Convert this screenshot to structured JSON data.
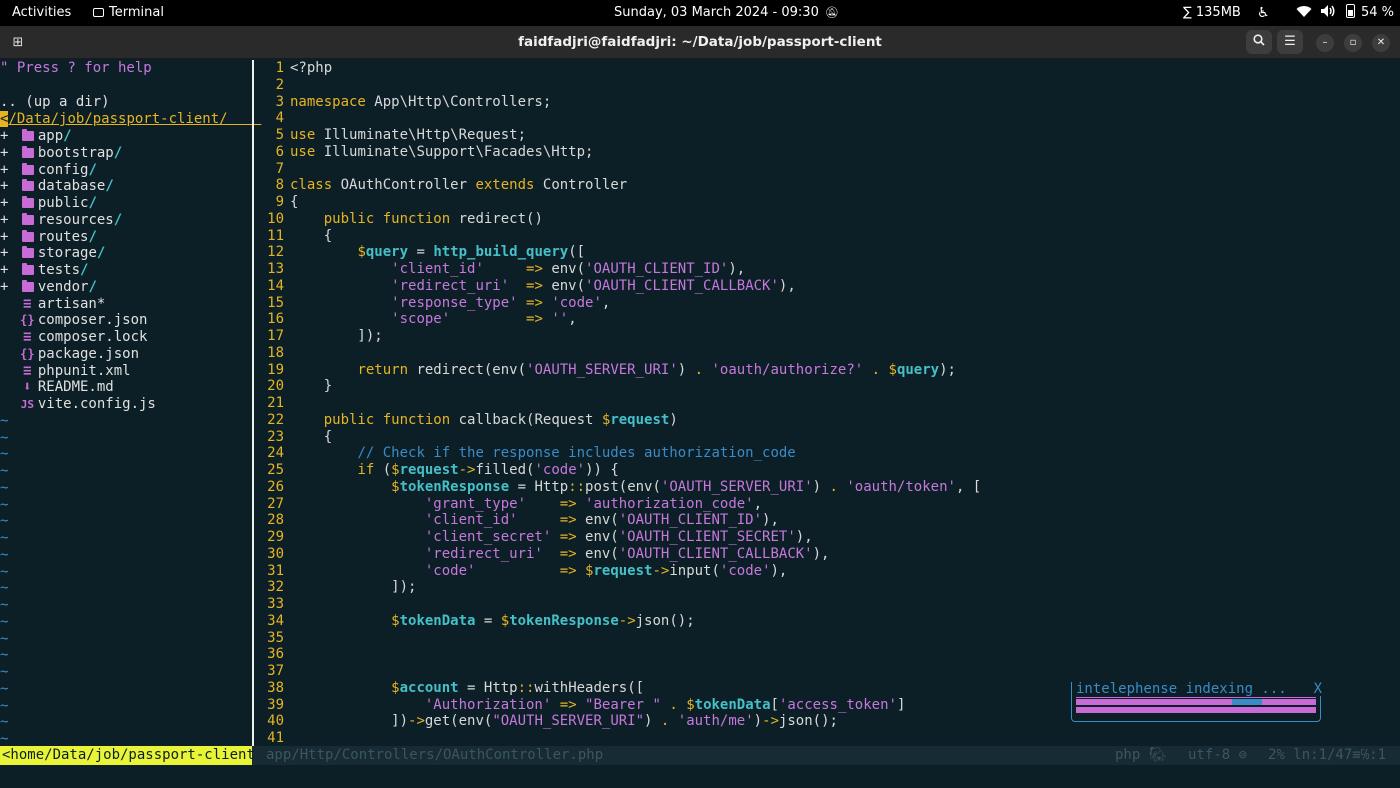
{
  "topbar": {
    "activities": "Activities",
    "app": "Terminal",
    "datetime": "Sunday, 03 March 2024 - 09:30",
    "memory": "∑ 135MB",
    "battery": "54 %"
  },
  "window": {
    "title": "faidfadjri@faidfadjri: ~/Data/job/passport-client"
  },
  "tree": {
    "help": "\" Press ? for help",
    "updir": ".. (up a dir)",
    "cwd": "/Data/job/passport-client/",
    "dirs": [
      "app",
      "bootstrap",
      "config",
      "database",
      "public",
      "resources",
      "routes",
      "storage",
      "tests",
      "vendor"
    ],
    "files": [
      {
        "icon": "text-file-icon",
        "glyph": "≡",
        "name": "artisan*"
      },
      {
        "icon": "json-file-icon",
        "glyph": "{}",
        "name": "composer.json"
      },
      {
        "icon": "text-file-icon",
        "glyph": "≡",
        "name": "composer.lock"
      },
      {
        "icon": "json-file-icon",
        "glyph": "{}",
        "name": "package.json"
      },
      {
        "icon": "text-file-icon",
        "glyph": "≡",
        "name": "phpunit.xml"
      },
      {
        "icon": "markdown-file-icon",
        "glyph": "⬇",
        "name": "README.md"
      },
      {
        "icon": "js-file-icon",
        "glyph": "JS",
        "name": "vite.config.js"
      }
    ],
    "tilde": "~"
  },
  "code": [
    [
      [
        "p",
        "<?php"
      ]
    ],
    [],
    [
      [
        "k",
        "namespace"
      ],
      [
        "p",
        " App\\Http\\Controllers;"
      ]
    ],
    [],
    [
      [
        "k",
        "use"
      ],
      [
        "p",
        " Illuminate\\Http\\Request;"
      ]
    ],
    [
      [
        "k",
        "use"
      ],
      [
        "p",
        " Illuminate\\Support\\Facades\\Http;"
      ]
    ],
    [],
    [
      [
        "k",
        "class"
      ],
      [
        "p",
        " OAuthController "
      ],
      [
        "k",
        "extends"
      ],
      [
        "p",
        " Controller"
      ]
    ],
    [
      [
        "p",
        "{"
      ]
    ],
    [
      [
        "p",
        "    "
      ],
      [
        "k",
        "public"
      ],
      [
        "p",
        " "
      ],
      [
        "k",
        "function"
      ],
      [
        "p",
        " redirect()"
      ]
    ],
    [
      [
        "p",
        "    {"
      ]
    ],
    [
      [
        "p",
        "        "
      ],
      [
        "d",
        "$"
      ],
      [
        "v",
        "query"
      ],
      [
        "p",
        " = "
      ],
      [
        "f",
        "http_build_query"
      ],
      [
        "p",
        "(["
      ]
    ],
    [
      [
        "p",
        "            "
      ],
      [
        "s",
        "'client_id'"
      ],
      [
        "p",
        "     "
      ],
      [
        "o",
        "=>"
      ],
      [
        "p",
        " env("
      ],
      [
        "s",
        "'OAUTH_CLIENT_ID'"
      ],
      [
        "p",
        "),"
      ]
    ],
    [
      [
        "p",
        "            "
      ],
      [
        "s",
        "'redirect_uri'"
      ],
      [
        "p",
        "  "
      ],
      [
        "o",
        "=>"
      ],
      [
        "p",
        " env("
      ],
      [
        "s",
        "'OAUTH_CLIENT_CALLBACK'"
      ],
      [
        "p",
        "),"
      ]
    ],
    [
      [
        "p",
        "            "
      ],
      [
        "s",
        "'response_type'"
      ],
      [
        "p",
        " "
      ],
      [
        "o",
        "=>"
      ],
      [
        "p",
        " "
      ],
      [
        "s",
        "'code'"
      ],
      [
        "p",
        ","
      ]
    ],
    [
      [
        "p",
        "            "
      ],
      [
        "s",
        "'scope'"
      ],
      [
        "p",
        "         "
      ],
      [
        "o",
        "=>"
      ],
      [
        "p",
        " "
      ],
      [
        "s",
        "''"
      ],
      [
        "p",
        ","
      ]
    ],
    [
      [
        "p",
        "        ]);"
      ]
    ],
    [],
    [
      [
        "p",
        "        "
      ],
      [
        "k",
        "return"
      ],
      [
        "p",
        " redirect(env("
      ],
      [
        "s",
        "'OAUTH_SERVER_URI'"
      ],
      [
        "p",
        ") "
      ],
      [
        "o",
        "."
      ],
      [
        "p",
        " "
      ],
      [
        "s",
        "'oauth/authorize?'"
      ],
      [
        "p",
        " "
      ],
      [
        "o",
        "."
      ],
      [
        "p",
        " "
      ],
      [
        "d",
        "$"
      ],
      [
        "v",
        "query"
      ],
      [
        "p",
        ");"
      ]
    ],
    [
      [
        "p",
        "    }"
      ]
    ],
    [],
    [
      [
        "p",
        "    "
      ],
      [
        "k",
        "public"
      ],
      [
        "p",
        " "
      ],
      [
        "k",
        "function"
      ],
      [
        "p",
        " callback(Request "
      ],
      [
        "d",
        "$"
      ],
      [
        "v",
        "request"
      ],
      [
        "p",
        ")"
      ]
    ],
    [
      [
        "p",
        "    {"
      ]
    ],
    [
      [
        "p",
        "        "
      ],
      [
        "c",
        "// Check if the response includes authorization_code"
      ]
    ],
    [
      [
        "p",
        "        "
      ],
      [
        "k",
        "if"
      ],
      [
        "p",
        " ("
      ],
      [
        "d",
        "$"
      ],
      [
        "v",
        "request"
      ],
      [
        "o",
        "->"
      ],
      [
        "p",
        "filled("
      ],
      [
        "s",
        "'code'"
      ],
      [
        "p",
        ")) {"
      ]
    ],
    [
      [
        "p",
        "            "
      ],
      [
        "d",
        "$"
      ],
      [
        "v",
        "tokenResponse"
      ],
      [
        "p",
        " = Http"
      ],
      [
        "o",
        "::"
      ],
      [
        "p",
        "post(env("
      ],
      [
        "s",
        "'OAUTH_SERVER_URI'"
      ],
      [
        "p",
        ") "
      ],
      [
        "o",
        "."
      ],
      [
        "p",
        " "
      ],
      [
        "s",
        "'oauth/token'"
      ],
      [
        "p",
        ", ["
      ]
    ],
    [
      [
        "p",
        "                "
      ],
      [
        "s",
        "'grant_type'"
      ],
      [
        "p",
        "    "
      ],
      [
        "o",
        "=>"
      ],
      [
        "p",
        " "
      ],
      [
        "s",
        "'authorization_code'"
      ],
      [
        "p",
        ","
      ]
    ],
    [
      [
        "p",
        "                "
      ],
      [
        "s",
        "'client_id'"
      ],
      [
        "p",
        "     "
      ],
      [
        "o",
        "=>"
      ],
      [
        "p",
        " env("
      ],
      [
        "s",
        "'OAUTH_CLIENT_ID'"
      ],
      [
        "p",
        "),"
      ]
    ],
    [
      [
        "p",
        "                "
      ],
      [
        "s",
        "'client_secret'"
      ],
      [
        "p",
        " "
      ],
      [
        "o",
        "=>"
      ],
      [
        "p",
        " env("
      ],
      [
        "s",
        "'OAUTH_CLIENT_SECRET'"
      ],
      [
        "p",
        "),"
      ]
    ],
    [
      [
        "p",
        "                "
      ],
      [
        "s",
        "'redirect_uri'"
      ],
      [
        "p",
        "  "
      ],
      [
        "o",
        "=>"
      ],
      [
        "p",
        " env("
      ],
      [
        "s",
        "'OAUTH_CLIENT_CALLBACK'"
      ],
      [
        "p",
        "),"
      ]
    ],
    [
      [
        "p",
        "                "
      ],
      [
        "s",
        "'code'"
      ],
      [
        "p",
        "          "
      ],
      [
        "o",
        "=>"
      ],
      [
        "p",
        " "
      ],
      [
        "d",
        "$"
      ],
      [
        "v",
        "request"
      ],
      [
        "o",
        "->"
      ],
      [
        "p",
        "input("
      ],
      [
        "s",
        "'code'"
      ],
      [
        "p",
        "),"
      ]
    ],
    [
      [
        "p",
        "            ]);"
      ]
    ],
    [],
    [
      [
        "p",
        "            "
      ],
      [
        "d",
        "$"
      ],
      [
        "v",
        "tokenData"
      ],
      [
        "p",
        " = "
      ],
      [
        "d",
        "$"
      ],
      [
        "v",
        "tokenResponse"
      ],
      [
        "o",
        "->"
      ],
      [
        "p",
        "json();"
      ]
    ],
    [],
    [],
    [],
    [
      [
        "p",
        "            "
      ],
      [
        "d",
        "$"
      ],
      [
        "v",
        "account"
      ],
      [
        "p",
        " = Http"
      ],
      [
        "o",
        "::"
      ],
      [
        "p",
        "withHeaders(["
      ]
    ],
    [
      [
        "p",
        "                "
      ],
      [
        "s",
        "'Authorization'"
      ],
      [
        "p",
        " "
      ],
      [
        "o",
        "=>"
      ],
      [
        "p",
        " "
      ],
      [
        "s",
        "\"Bearer \""
      ],
      [
        "p",
        " "
      ],
      [
        "o",
        "."
      ],
      [
        "p",
        " "
      ],
      [
        "d",
        "$"
      ],
      [
        "v",
        "tokenData"
      ],
      [
        "p",
        "["
      ],
      [
        "s",
        "'access_token'"
      ],
      [
        "p",
        "]"
      ]
    ],
    [
      [
        "p",
        "            ])"
      ],
      [
        "o",
        "->"
      ],
      [
        "p",
        "get(env("
      ],
      [
        "s",
        "\"OAUTH_SERVER_URI\""
      ],
      [
        "p",
        ") "
      ],
      [
        "o",
        "."
      ],
      [
        "p",
        " "
      ],
      [
        "s",
        "'auth/me'"
      ],
      [
        "p",
        ")"
      ],
      [
        "o",
        "->"
      ],
      [
        "p",
        "json();"
      ]
    ],
    []
  ],
  "statusline": {
    "cwd": "<home/Data/job/passport-client",
    "file": "app/Http/Controllers/OAuthController.php",
    "filetype": "php",
    "encoding": "utf-8",
    "position": "2% ln:1/47≡℅:1"
  },
  "popup": {
    "title": "intelephense indexing ... ",
    "close": "X",
    "progress": 0.5
  }
}
